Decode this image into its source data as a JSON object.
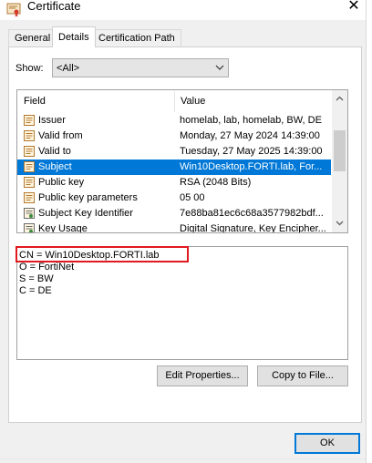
{
  "window": {
    "title": "Certificate",
    "close_glyph": "✕"
  },
  "tabs": [
    {
      "label": "General",
      "active": false
    },
    {
      "label": "Details",
      "active": true
    },
    {
      "label": "Certification Path",
      "active": false
    }
  ],
  "show": {
    "label": "Show:",
    "selected": "<All>"
  },
  "columns": {
    "field": "Field",
    "value": "Value"
  },
  "rows": [
    {
      "field": "Issuer",
      "value": "homelab, lab, homelab, BW, DE",
      "icon": "certificate-field-icon",
      "selected": false
    },
    {
      "field": "Valid from",
      "value": "Monday, 27 May 2024 14:39:00",
      "icon": "certificate-field-icon",
      "selected": false
    },
    {
      "field": "Valid to",
      "value": "Tuesday, 27 May 2025 14:39:00",
      "icon": "certificate-field-icon",
      "selected": false
    },
    {
      "field": "Subject",
      "value": "Win10Desktop.FORTI.lab, For...",
      "icon": "certificate-field-icon",
      "selected": true
    },
    {
      "field": "Public key",
      "value": "RSA (2048 Bits)",
      "icon": "certificate-field-icon",
      "selected": false
    },
    {
      "field": "Public key parameters",
      "value": "05 00",
      "icon": "certificate-field-icon",
      "selected": false
    },
    {
      "field": "Subject Key Identifier",
      "value": "7e88ba81ec6c68a3577982bdf...",
      "icon": "extension-icon",
      "selected": false
    },
    {
      "field": "Key Usage",
      "value": "Digital Signature, Key Encipher...",
      "icon": "extension-icon",
      "selected": false
    }
  ],
  "detail_lines": [
    "CN = Win10Desktop.FORTI.lab",
    "O = FortiNet",
    "S = BW",
    "C = DE"
  ],
  "buttons": {
    "edit_properties": "Edit Properties...",
    "copy_to_file": "Copy to File...",
    "ok": "OK"
  },
  "colors": {
    "selection": "#0078d7",
    "highlight_box": "#e0191f"
  }
}
